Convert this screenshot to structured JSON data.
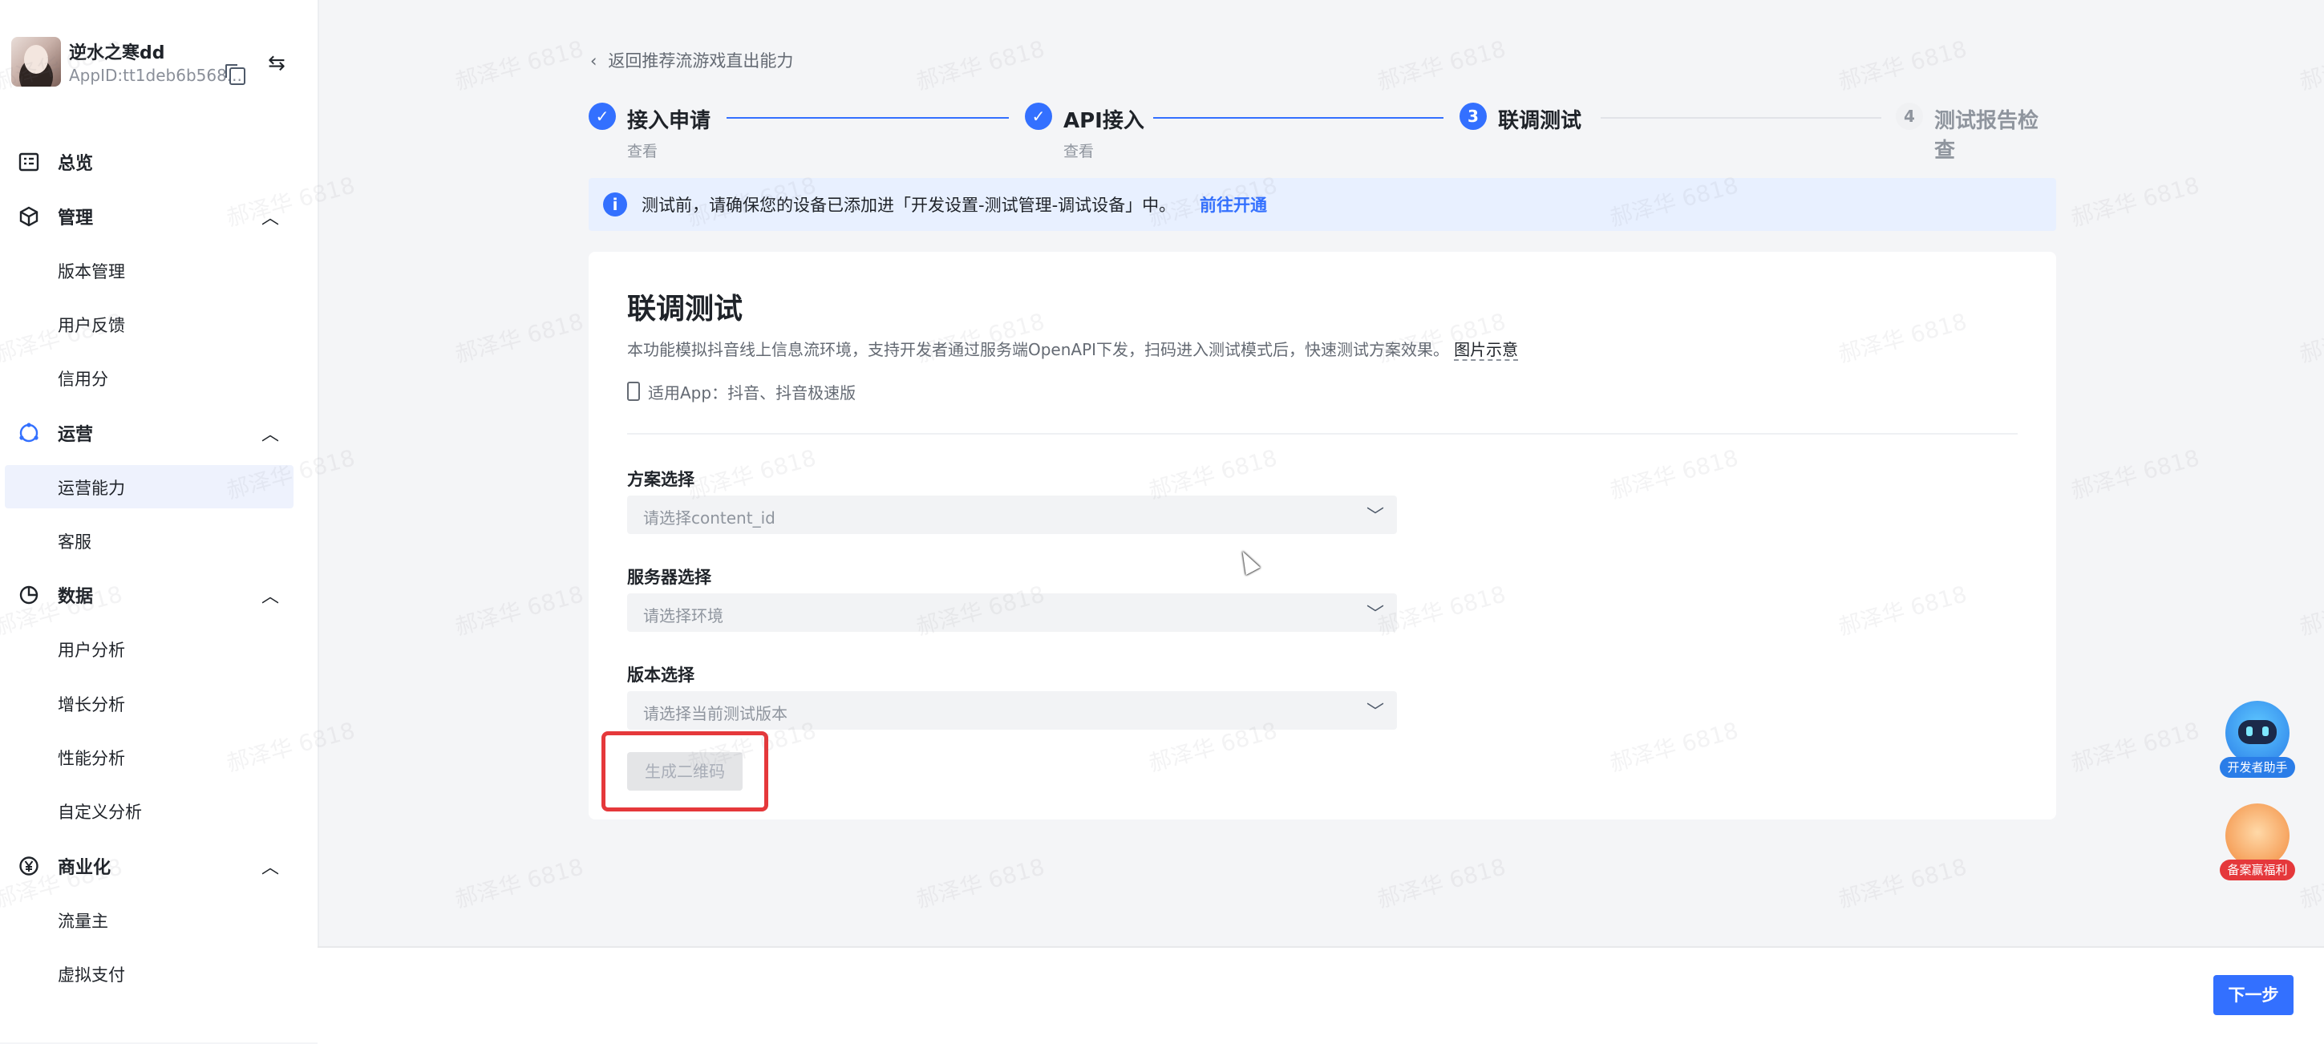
{
  "account": {
    "name": "逆水之寒dd",
    "app_id": "AppID:tt1deb6b568..."
  },
  "nav": {
    "overview": "总览",
    "manage": {
      "label": "管理",
      "items": [
        "版本管理",
        "用户反馈",
        "信用分"
      ]
    },
    "operation": {
      "label": "运营",
      "items": [
        "运营能力",
        "客服"
      ]
    },
    "data": {
      "label": "数据",
      "items": [
        "用户分析",
        "增长分析",
        "性能分析",
        "自定义分析"
      ]
    },
    "commerce": {
      "label": "商业化",
      "items": [
        "流量主",
        "虚拟支付"
      ]
    }
  },
  "back_link": "返回推荐流游戏直出能力",
  "steps": [
    {
      "num": "1",
      "title": "接入申请",
      "sub": "查看",
      "status": "done"
    },
    {
      "num": "2",
      "title": "API接入",
      "sub": "查看",
      "status": "done"
    },
    {
      "num": "3",
      "title": "联调测试",
      "sub": "",
      "status": "current"
    },
    {
      "num": "4",
      "title": "测试报告检查",
      "sub": "",
      "status": "pending"
    }
  ],
  "notice": {
    "text": "测试前，请确保您的设备已添加进「开发设置-测试管理-调试设备」中。",
    "link": "前往开通"
  },
  "card": {
    "title": "联调测试",
    "desc": "本功能模拟抖音线上信息流环境，支持开发者通过服务端OpenAPI下发，扫码进入测试模式后，快速测试方案效果。",
    "desc_link": "图片示意",
    "app_line": "适用App：抖音、抖音极速版",
    "fields": [
      {
        "label": "方案选择",
        "placeholder": "请选择content_id"
      },
      {
        "label": "服务器选择",
        "placeholder": "请选择环境"
      },
      {
        "label": "版本选择",
        "placeholder": "请选择当前测试版本"
      }
    ],
    "qr_button": "生成二维码"
  },
  "next_button": "下一步",
  "floaters": {
    "assistant": "开发者助手",
    "gift": "备案赢福利"
  },
  "watermark": "郝泽华 6818",
  "colors": {
    "primary": "#3370ff",
    "highlight": "#e5383b",
    "notice_bg": "#e8f0ff"
  }
}
